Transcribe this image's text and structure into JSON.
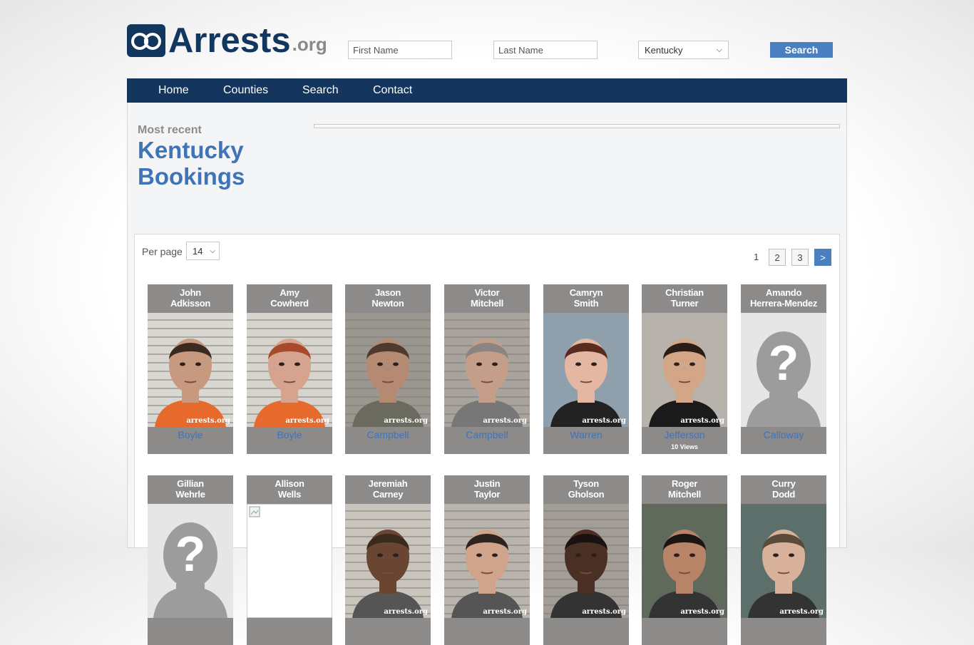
{
  "header": {
    "logo_main": "Arrests",
    "logo_suffix": ".org",
    "first_name_placeholder": "First Name",
    "last_name_placeholder": "Last Name",
    "state_selected": "Kentucky",
    "search_label": "Search"
  },
  "nav": {
    "items": [
      "Home",
      "Counties",
      "Search",
      "Contact"
    ]
  },
  "page": {
    "kicker": "Most recent",
    "title_line1": "Kentucky",
    "title_line2": "Bookings"
  },
  "listing": {
    "per_page_label": "Per page",
    "per_page_value": "14",
    "pages": [
      "1",
      "2",
      "3"
    ],
    "next_label": ">",
    "watermark": "arrests.org",
    "cards": [
      {
        "first": "John",
        "last": "Adkisson",
        "county": "Boyle",
        "views": "",
        "photo": "mugshot"
      },
      {
        "first": "Amy",
        "last": "Cowherd",
        "county": "Boyle",
        "views": "",
        "photo": "mugshot"
      },
      {
        "first": "Jason",
        "last": "Newton",
        "county": "Campbell",
        "views": "",
        "photo": "mugshot"
      },
      {
        "first": "Victor",
        "last": "Mitchell",
        "county": "Campbell",
        "views": "",
        "photo": "mugshot"
      },
      {
        "first": "Camryn",
        "last": "Smith",
        "county": "Warren",
        "views": "",
        "photo": "mugshot"
      },
      {
        "first": "Christian",
        "last": "Turner",
        "county": "Jefferson",
        "views": "10 Views",
        "photo": "mugshot"
      },
      {
        "first": "Amando",
        "last": "Herrera-Mendez",
        "county": "Calloway",
        "views": "",
        "photo": "placeholder"
      },
      {
        "first": "Gillian",
        "last": "Wehrle",
        "county": "",
        "views": "",
        "photo": "placeholder"
      },
      {
        "first": "Allison",
        "last": "Wells",
        "county": "",
        "views": "",
        "photo": "broken"
      },
      {
        "first": "Jeremiah",
        "last": "Carney",
        "county": "",
        "views": "",
        "photo": "mugshot"
      },
      {
        "first": "Justin",
        "last": "Taylor",
        "county": "",
        "views": "",
        "photo": "mugshot"
      },
      {
        "first": "Tyson",
        "last": "Gholson",
        "county": "",
        "views": "",
        "photo": "mugshot"
      },
      {
        "first": "Roger",
        "last": "Mitchell",
        "county": "",
        "views": "",
        "photo": "mugshot"
      },
      {
        "first": "Curry",
        "last": "Dodd",
        "county": "",
        "views": "",
        "photo": "mugshot"
      }
    ]
  },
  "colors": {
    "brand_navy": "#14365e",
    "accent_blue": "#3f74b8",
    "card_gray": "#8d8a8a"
  }
}
